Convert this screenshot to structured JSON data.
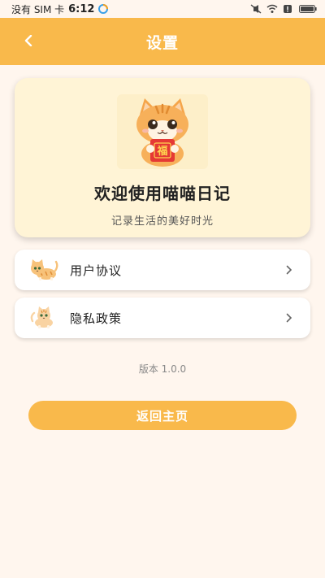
{
  "status_bar": {
    "carrier": "没有 SIM 卡",
    "time": "6:12",
    "icons": [
      "app-badge-icon",
      "mute-icon",
      "wifi-icon",
      "alert-icon",
      "battery-icon"
    ]
  },
  "header": {
    "title": "设置",
    "back_icon": "chevron-left-icon"
  },
  "hero": {
    "logo_text": "福",
    "title": "欢迎使用喵喵日记",
    "subtitle": "记录生活的美好时光"
  },
  "menu": [
    {
      "label": "用户协议",
      "icon": "cat-icon"
    },
    {
      "label": "隐私政策",
      "icon": "cat-icon"
    }
  ],
  "version": "版本 1.0.0",
  "home_button": {
    "label": "返回主页"
  },
  "colors": {
    "accent": "#F9B94B",
    "background": "#FFF6EE",
    "card": "#FFF4D6"
  }
}
